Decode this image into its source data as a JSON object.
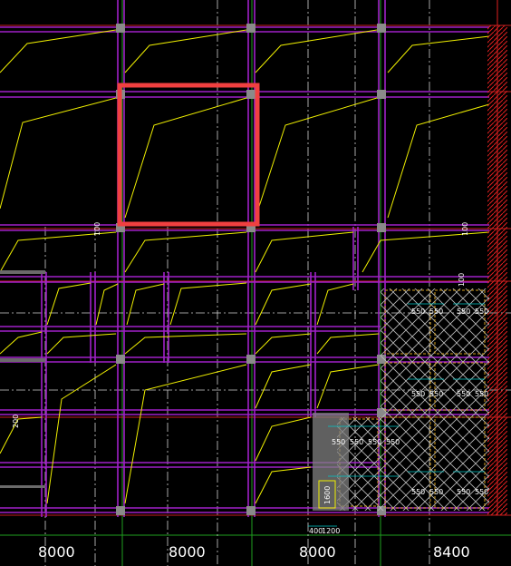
{
  "drawing": {
    "background": "#000000",
    "colors": {
      "beam": "#a020c8",
      "beam_inner": "#5a1a8a",
      "axis": "#c81e1e",
      "grid_dash": "#d0d0d0",
      "green_grid": "#1fa01f",
      "yellow": "#f0f000",
      "column": "#8a8a8a",
      "highlight": "#f04040",
      "hatch": "#c8c8c8",
      "cyan_dim": "#00c8c8",
      "red_hatch": "#e02020",
      "white": "#ffffff"
    }
  },
  "dimensions": {
    "bays": [
      {
        "label": "8000"
      },
      {
        "label": "8000"
      },
      {
        "label": "8000"
      },
      {
        "label": "8400"
      }
    ]
  },
  "annotations": {
    "beam_marks": [
      "100",
      "100",
      "100",
      "200"
    ],
    "pile_dims": [
      "550",
      "550"
    ],
    "small_dims": [
      "400",
      "1200"
    ],
    "yellow_box_label": "1600"
  },
  "selection": {
    "label": "selected-bay"
  }
}
